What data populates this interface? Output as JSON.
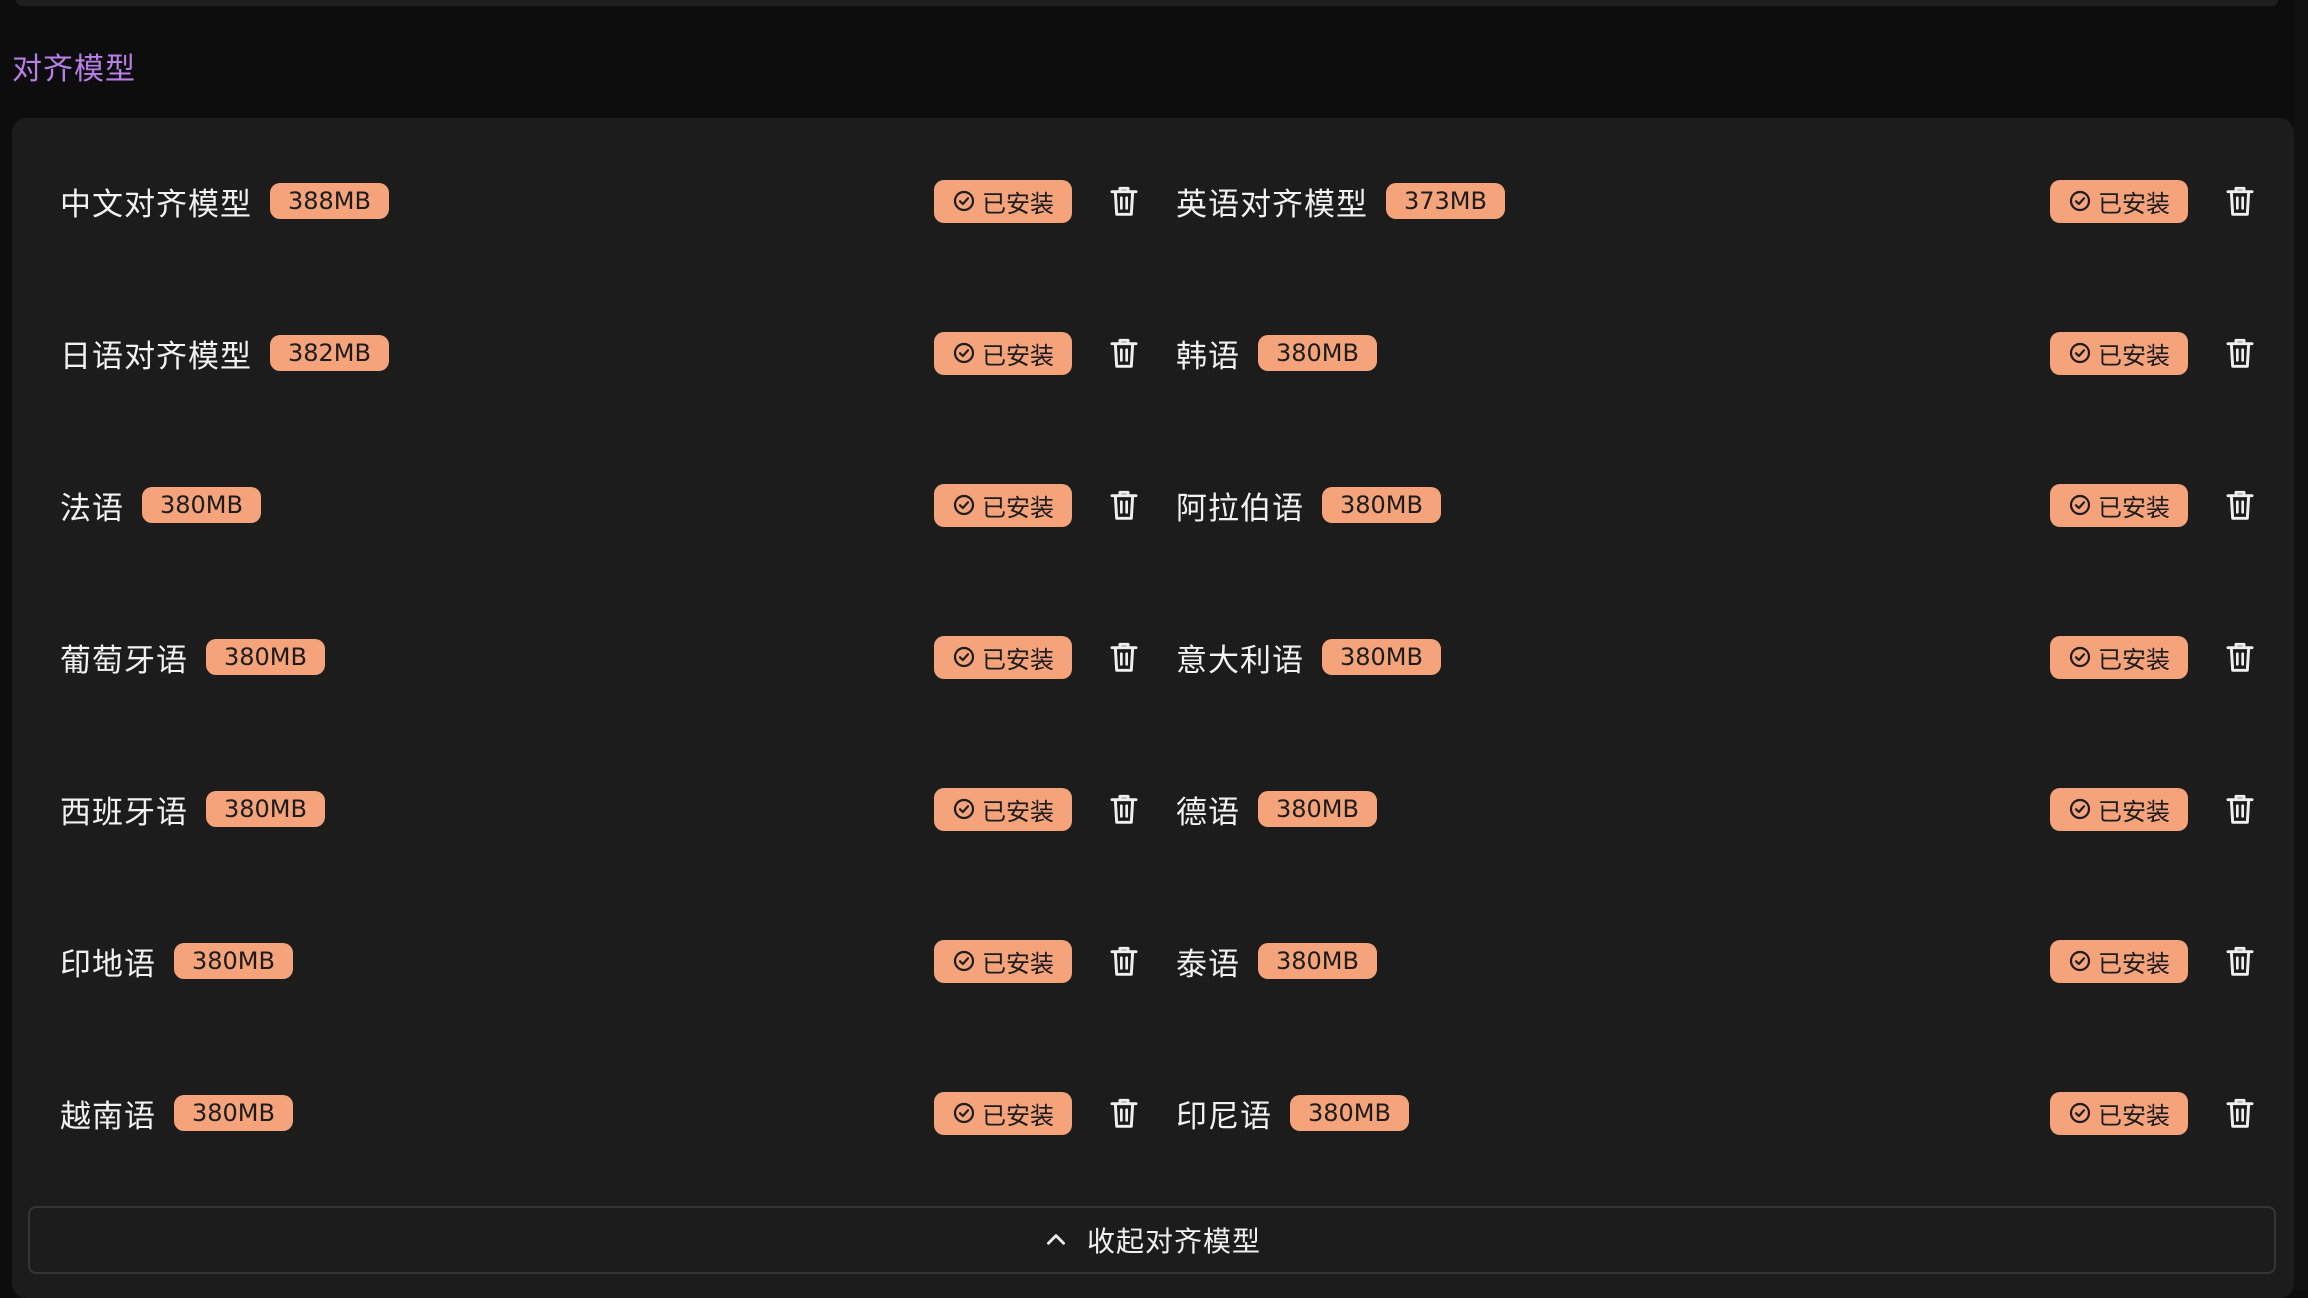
{
  "section": {
    "title": "对齐模型"
  },
  "status_label": "已安装",
  "colors": {
    "accent": "#f4a37b",
    "title": "#b87fe8",
    "panel": "#1c1c1c"
  },
  "models": [
    {
      "name": "中文对齐模型",
      "size": "388MB"
    },
    {
      "name": "英语对齐模型",
      "size": "373MB"
    },
    {
      "name": "日语对齐模型",
      "size": "382MB"
    },
    {
      "name": "韩语",
      "size": "380MB"
    },
    {
      "name": "法语",
      "size": "380MB"
    },
    {
      "name": "阿拉伯语",
      "size": "380MB"
    },
    {
      "name": "葡萄牙语",
      "size": "380MB"
    },
    {
      "name": "意大利语",
      "size": "380MB"
    },
    {
      "name": "西班牙语",
      "size": "380MB"
    },
    {
      "name": "德语",
      "size": "380MB"
    },
    {
      "name": "印地语",
      "size": "380MB"
    },
    {
      "name": "泰语",
      "size": "380MB"
    },
    {
      "name": "越南语",
      "size": "380MB"
    },
    {
      "name": "印尼语",
      "size": "380MB"
    }
  ],
  "collapse_button": {
    "label": "收起对齐模型",
    "icon": "chevron-up-icon"
  },
  "icons": {
    "status": "check-circle-icon",
    "delete": "trash-icon"
  }
}
